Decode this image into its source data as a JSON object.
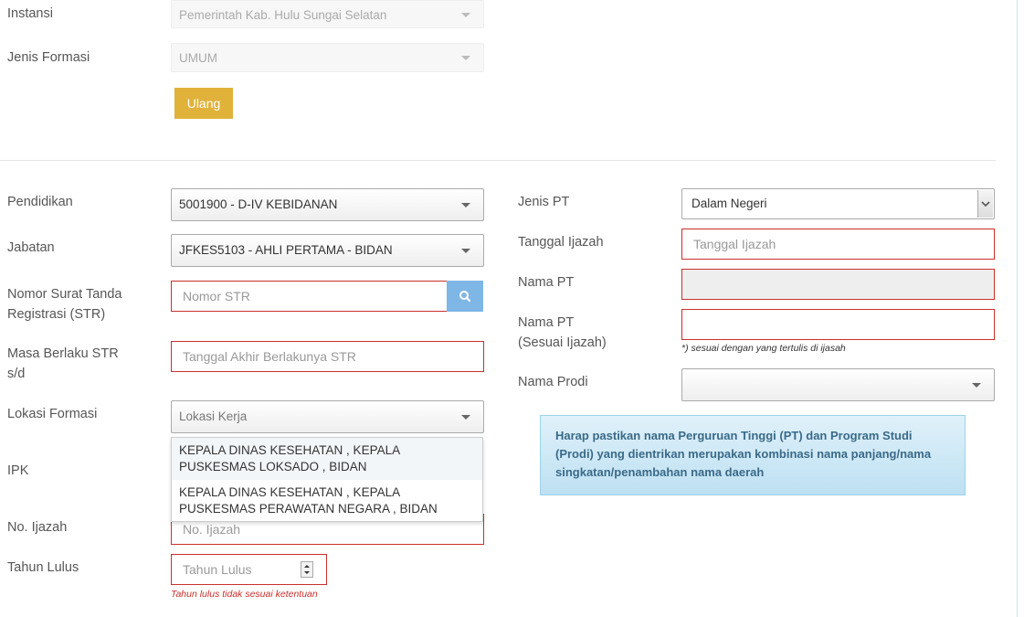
{
  "top": {
    "instansi_label": "Instansi",
    "instansi_value": "Pemerintah Kab. Hulu Sungai Selatan",
    "jenis_formasi_label": "Jenis Formasi",
    "jenis_formasi_value": "UMUM",
    "ulang_label": "Ulang"
  },
  "left": {
    "pendidikan_label": "Pendidikan",
    "pendidikan_value": "5001900 - D-IV KEBIDANAN",
    "jabatan_label": "Jabatan",
    "jabatan_value": "JFKES5103 - AHLI PERTAMA - BIDAN",
    "str_label_1": "Nomor Surat Tanda",
    "str_label_2": "Registrasi (STR)",
    "str_placeholder": "Nomor STR",
    "masa_label_1": "Masa Berlaku STR",
    "masa_label_2": "s/d",
    "masa_placeholder": "Tanggal Akhir Berlakunya STR",
    "lokasi_label": "Lokasi Formasi",
    "lokasi_placeholder": "Lokasi Kerja",
    "lokasi_options": [
      {
        "line1": "KEPALA DINAS KESEHATAN , KEPALA",
        "line2": "PUSKESMAS LOKSADO , BIDAN"
      },
      {
        "line1": "KEPALA DINAS KESEHATAN , KEPALA",
        "line2": "PUSKESMAS PERAWATAN NEGARA , BIDAN"
      }
    ],
    "ipk_label": "IPK",
    "ijazah_label": "No. Ijazah",
    "ijazah_placeholder": "No. Ijazah",
    "tahun_label": "Tahun Lulus",
    "tahun_placeholder": "Tahun Lulus",
    "tahun_error": "Tahun lulus tidak sesuai ketentuan"
  },
  "right": {
    "jenis_pt_label": "Jenis PT",
    "jenis_pt_value": "Dalam Negeri",
    "tgl_ijazah_label": "Tanggal Ijazah",
    "tgl_ijazah_placeholder": "Tanggal Ijazah",
    "nama_pt_label": "Nama PT",
    "nama_pt2_label_1": "Nama PT",
    "nama_pt2_label_2": "(Sesuai Ijazah)",
    "nama_pt2_hint": "*) sesuai dengan yang tertulis di ijasah",
    "prodi_label": "Nama Prodi",
    "alert_text": "Harap pastikan nama Perguruan Tinggi (PT) dan Program Studi (Prodi) yang dientrikan merupakan kombinasi nama panjang/nama singkatan/penambahan nama daerah"
  }
}
